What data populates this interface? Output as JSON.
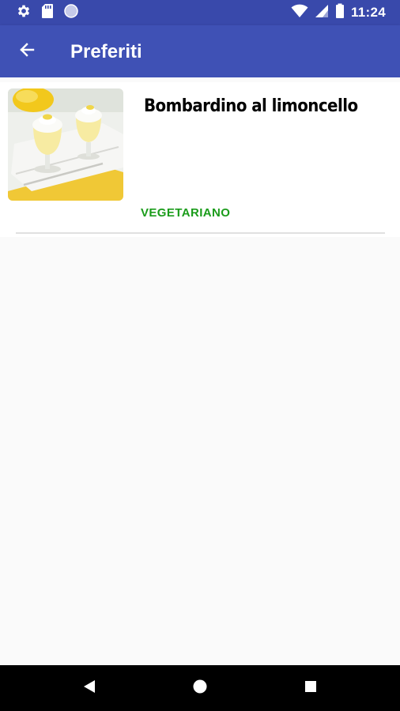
{
  "status_bar": {
    "time": "11:24",
    "icons": [
      "gear-icon",
      "sd-card-icon",
      "circle-icon",
      "wifi-icon",
      "signal-icon",
      "battery-icon"
    ]
  },
  "app_bar": {
    "title": "Preferiti",
    "back_icon": "arrow-left-icon"
  },
  "favorites": [
    {
      "title": "Bombardino al limoncello",
      "tag": "VEGETARIANO",
      "image": "lemon-dessert-glasses"
    }
  ],
  "nav_bar": {
    "icons": [
      "back-triangle-icon",
      "home-circle-icon",
      "recents-square-icon"
    ]
  },
  "colors": {
    "status_bar": "#3949ab",
    "app_bar": "#3f51b5",
    "tag": "#1b9c1b",
    "background": "#fafafa"
  }
}
